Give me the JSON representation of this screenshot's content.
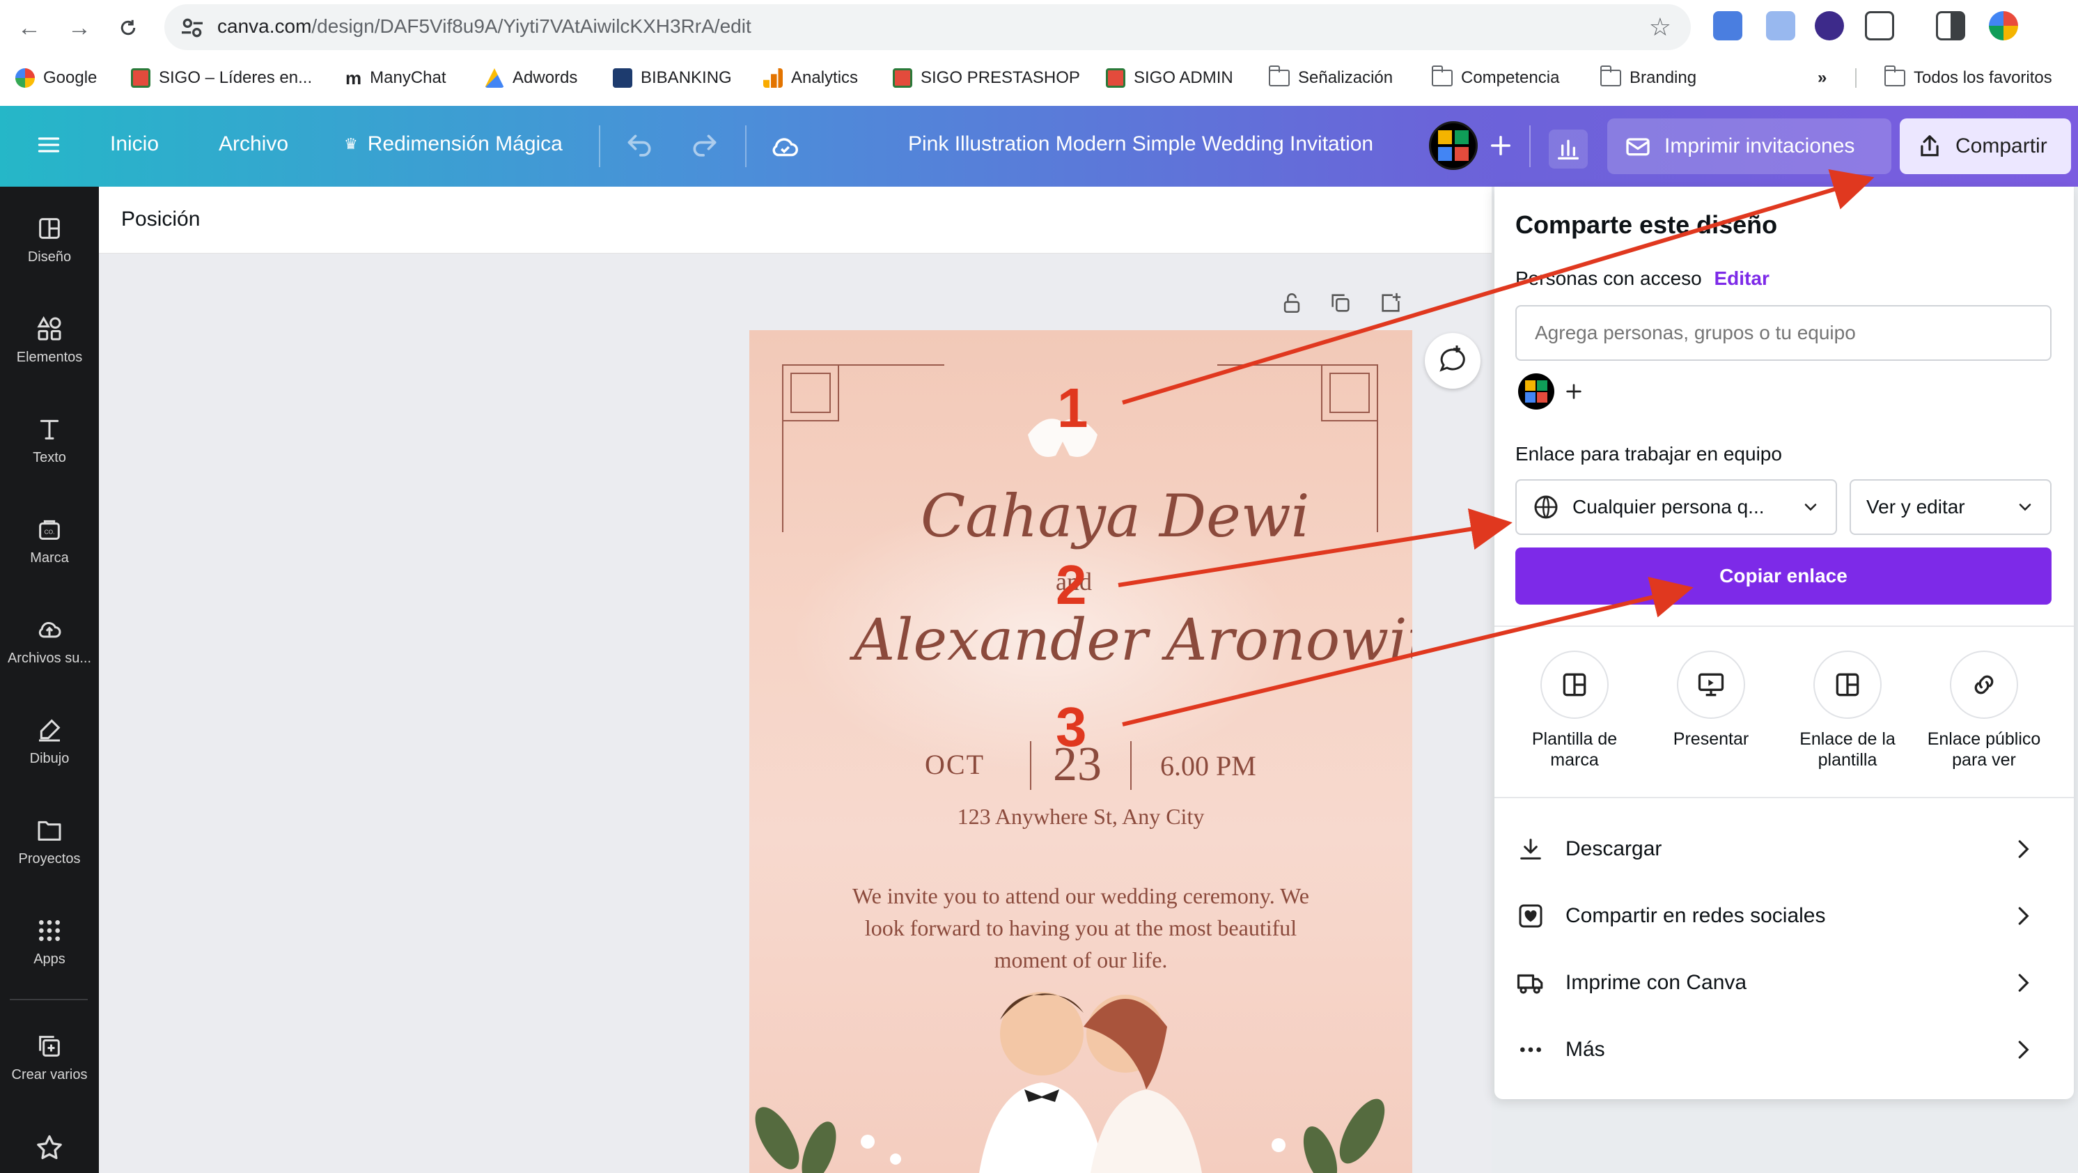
{
  "browser": {
    "url_host": "canva.com",
    "url_path": "/design/DAF5Vif8u9A/Yiyti7VAtAiwilcKXH3RrA/edit",
    "bookmarks": [
      {
        "label": "Google"
      },
      {
        "label": "SIGO – Líderes en..."
      },
      {
        "label": "ManyChat"
      },
      {
        "label": "Adwords"
      },
      {
        "label": "BIBANKING"
      },
      {
        "label": "Analytics"
      },
      {
        "label": "SIGO PRESTASHOP"
      },
      {
        "label": "SIGO ADMIN"
      },
      {
        "label": "Señalización"
      },
      {
        "label": "Competencia"
      },
      {
        "label": "Branding"
      }
    ],
    "bookmarks_overflow": "»",
    "all_bookmarks": "Todos los favoritos"
  },
  "header": {
    "home": "Inicio",
    "file": "Archivo",
    "magic_resize": "Redimensión Mágica",
    "design_title": "Pink Illustration Modern Simple Wedding Invitation",
    "print_button": "Imprimir invitaciones",
    "share_button": "Compartir"
  },
  "sidebar": {
    "items": [
      {
        "label": "Diseño"
      },
      {
        "label": "Elementos"
      },
      {
        "label": "Texto"
      },
      {
        "label": "Marca"
      },
      {
        "label": "Archivos su..."
      },
      {
        "label": "Dibujo"
      },
      {
        "label": "Proyectos"
      },
      {
        "label": "Apps"
      },
      {
        "label": "Crear varios"
      }
    ]
  },
  "context_bar": {
    "position_label": "Posición"
  },
  "design": {
    "name1": "Cahaya Dewi",
    "and": "and",
    "name2": "Alexander Aronowitz",
    "month": "OCT",
    "day": "23",
    "time": "6.00 PM",
    "address": "123 Anywhere St, Any City",
    "message_line1": "We invite you to attend our wedding ceremony. We",
    "message_line2": "look forward to having you at the most beautiful",
    "message_line3": "moment of our life."
  },
  "annotations": {
    "step1": "1",
    "step2": "2",
    "step3": "3",
    "color": "#e0381f"
  },
  "share_panel": {
    "title": "Comparte este diseño",
    "people_label": "Personas con acceso",
    "edit_link": "Editar",
    "add_people_placeholder": "Agrega personas, grupos o tu equipo",
    "team_link_label": "Enlace para trabajar en equipo",
    "access_select": "Cualquier persona q...",
    "permission_select": "Ver y editar",
    "copy_link_button": "Copiar enlace",
    "options": [
      {
        "label_line1": "Plantilla de",
        "label_line2": "marca"
      },
      {
        "label_line1": "Presentar",
        "label_line2": ""
      },
      {
        "label_line1": "Enlace de la",
        "label_line2": "plantilla"
      },
      {
        "label_line1": "Enlace público",
        "label_line2": "para ver"
      }
    ],
    "rows": [
      {
        "label": "Descargar"
      },
      {
        "label": "Compartir en redes sociales"
      },
      {
        "label": "Imprime con Canva"
      },
      {
        "label": "Más"
      }
    ]
  },
  "colors": {
    "accent_purple": "#7d2ae8",
    "sidebar_bg": "#18191b",
    "header_gradient_start": "#25b7c8",
    "header_gradient_end": "#7b5ce0"
  }
}
